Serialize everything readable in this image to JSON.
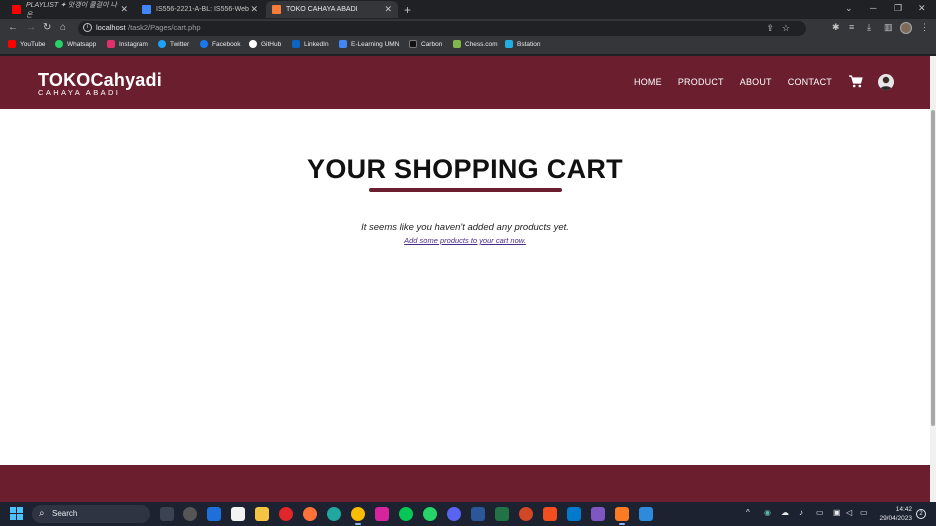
{
  "browser": {
    "tabs": [
      {
        "title": "PLAYLIST ✦ 맛갱이 쿨걸이 나온",
        "active": false
      },
      {
        "title": "IS556-2221-A-BL: IS556-Web Dev",
        "active": false
      },
      {
        "title": "TOKO CAHAYA ABADI",
        "active": true
      }
    ],
    "url_host": "localhost",
    "url_path": "/task2/Pages/cart.php",
    "bookmarks": [
      {
        "label": "YouTube",
        "color": "#ff0000"
      },
      {
        "label": "Whatsapp",
        "color": "#25d366"
      },
      {
        "label": "Instagram",
        "color": "#e1306c"
      },
      {
        "label": "Twitter",
        "color": "#1da1f2"
      },
      {
        "label": "Facebook",
        "color": "#1877f2"
      },
      {
        "label": "GitHub",
        "color": "#ffffff"
      },
      {
        "label": "LinkedIn",
        "color": "#0a66c2"
      },
      {
        "label": "E-Learning UMN",
        "color": "#4285f4"
      },
      {
        "label": "Carbon",
        "color": "#111111"
      },
      {
        "label": "Chess.com",
        "color": "#81b64c"
      },
      {
        "label": "Bstation",
        "color": "#23ade5"
      }
    ]
  },
  "site": {
    "brand_name": "TOKOCahyadi",
    "brand_tagline": "CAHAYA ABADI",
    "nav": [
      "HOME",
      "PRODUCT",
      "ABOUT",
      "CONTACT"
    ],
    "accent_color": "#6b1f2e"
  },
  "cart": {
    "title": "YOUR SHOPPING CART",
    "empty_message": "It seems like you haven't added any products yet.",
    "add_link": "Add some products to your cart now."
  },
  "taskbar": {
    "search_label": "Search",
    "time": "14:42",
    "date": "29/04/2023",
    "notifications": "2"
  }
}
